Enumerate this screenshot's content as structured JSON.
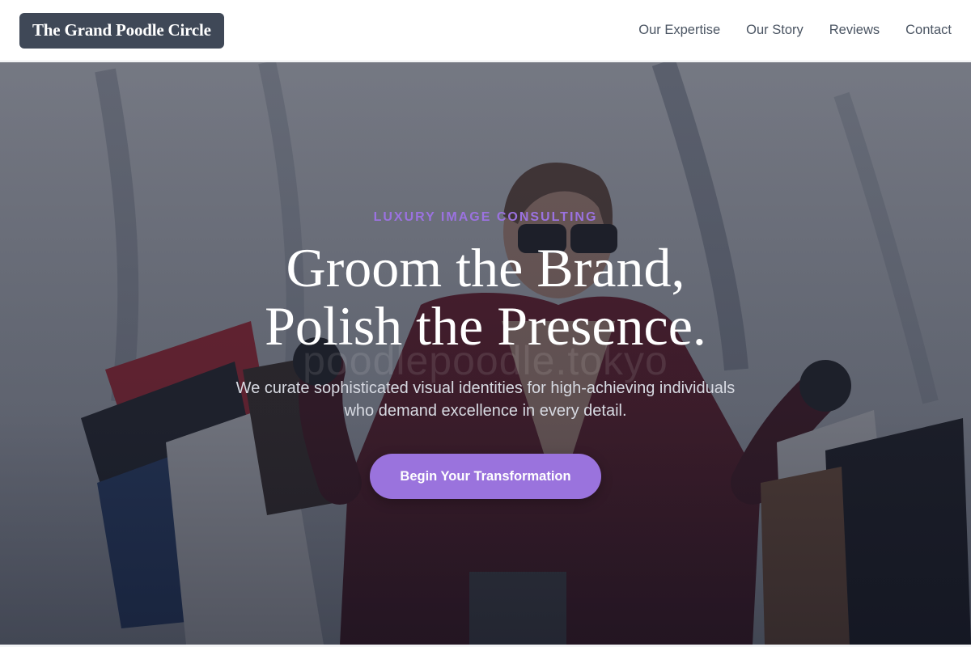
{
  "header": {
    "logo_text": "The Grand Poodle Circle",
    "nav": [
      {
        "label": "Our Expertise"
      },
      {
        "label": "Our Story"
      },
      {
        "label": "Reviews"
      },
      {
        "label": "Contact"
      }
    ]
  },
  "hero": {
    "eyebrow": "LUXURY IMAGE CONSULTING",
    "headline_line1": "Groom the Brand,",
    "headline_line2": "Polish the Presence.",
    "watermark": "poodlepoodle.tokyo",
    "subtext_line1": "We curate sophisticated visual identities for high-achieving individuals",
    "subtext_line2": "who demand excellence in every detail.",
    "cta_label": "Begin Your Transformation",
    "background_image": "woman-with-shopping-bags-photo"
  },
  "colors": {
    "accent": "#9a73dd",
    "eyebrow": "#9b72e0",
    "logo_bg": "#3f4857",
    "nav_text": "#4b5563"
  }
}
